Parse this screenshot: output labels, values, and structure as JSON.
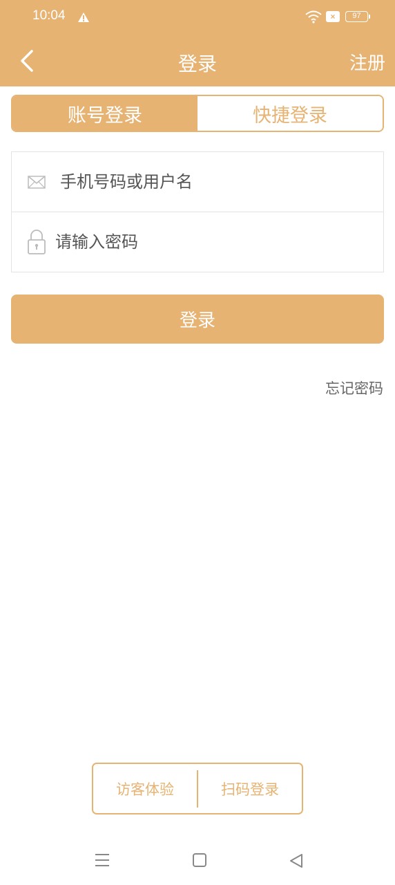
{
  "status_bar": {
    "time": "10:04",
    "battery": "97",
    "sim_badge": "×"
  },
  "nav": {
    "title": "登录",
    "register": "注册"
  },
  "tabs": [
    {
      "label": "账号登录",
      "active": true
    },
    {
      "label": "快捷登录",
      "active": false
    }
  ],
  "form": {
    "username_placeholder": "手机号码或用户名",
    "password_placeholder": "请输入密码"
  },
  "login_button": "登录",
  "forgot_password": "忘记密码",
  "bottom_options": {
    "guest": "访客体验",
    "scan": "扫码登录"
  },
  "icons": {
    "back": "chevron-left-icon",
    "warning": "warning-icon",
    "wifi": "wifi-icon",
    "mail": "mail-icon",
    "lock": "lock-icon",
    "menu": "menu-icon",
    "home": "home-square-icon",
    "nav_back": "triangle-back-icon"
  },
  "colors": {
    "accent": "#e6b373",
    "background": "#ffffff",
    "border": "#e3e3e3"
  }
}
